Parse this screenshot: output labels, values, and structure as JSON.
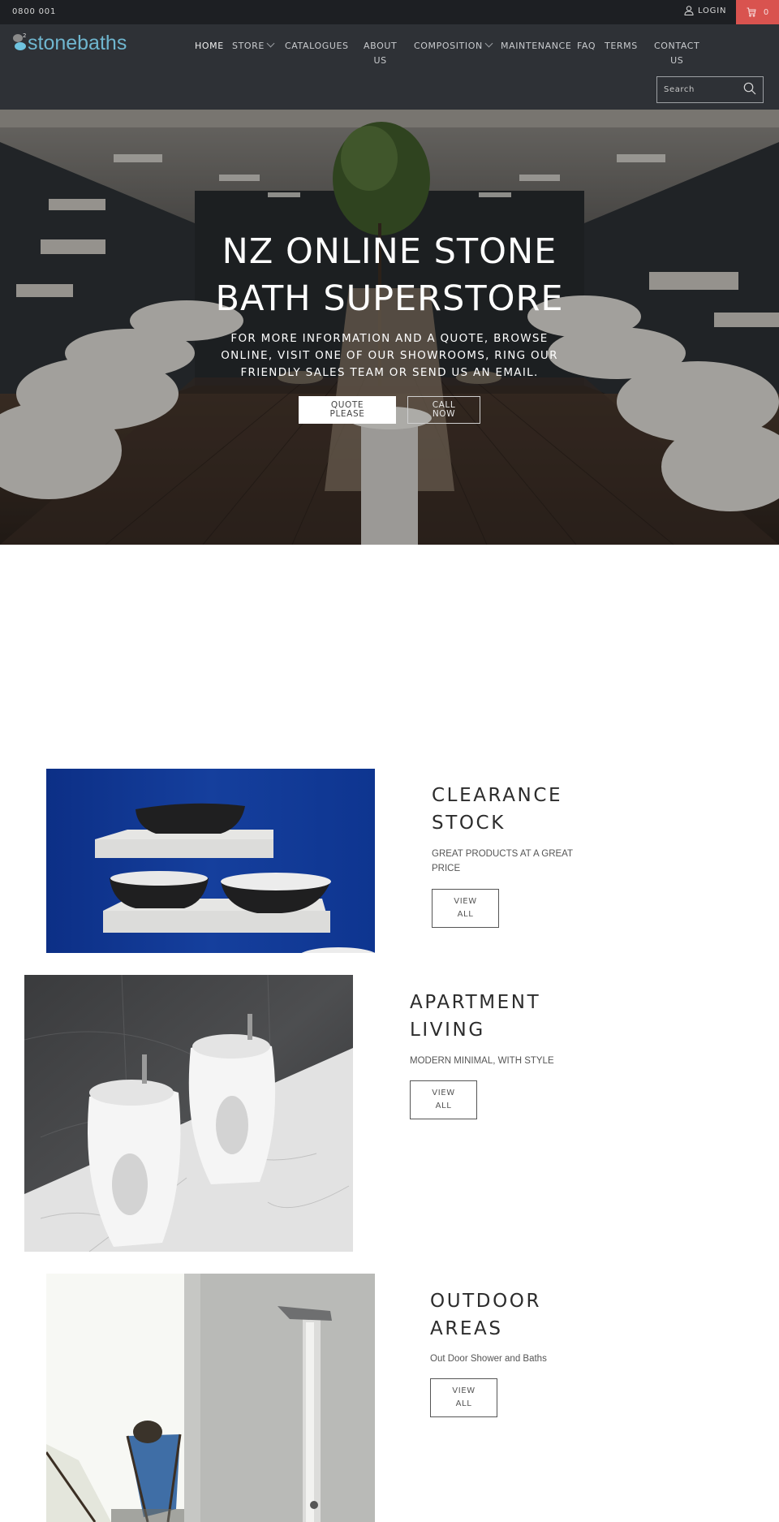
{
  "topbar": {
    "phone": "0800 001",
    "login_label": "LOGIN",
    "cart_count": "0",
    "cart_color": "#d9534f"
  },
  "header": {
    "logo_text": "stonebaths",
    "logo_superscript": "2",
    "nav": [
      {
        "label": "HOME",
        "active": true
      },
      {
        "label": "STORE",
        "has_dropdown": true
      },
      {
        "label": "CATALOGUES"
      },
      {
        "label_line1": "ABOUT",
        "label_line2": "US"
      },
      {
        "label": "COMPOSITION",
        "has_dropdown": true
      },
      {
        "label": "MAINTENANCE"
      },
      {
        "label": "FAQ"
      },
      {
        "label": "TERMS"
      },
      {
        "label_line1": "CONTACT",
        "label_line2": "US"
      }
    ],
    "search_placeholder": "Search"
  },
  "hero": {
    "title_line1": "NZ ONLINE STONE",
    "title_line2": "BATH SUPERSTORE",
    "subtitle": "FOR MORE INFORMATION AND A QUOTE, BROWSE ONLINE, VISIT ONE OF OUR SHOWROOMS, RING OUR FRIENDLY SALES TEAM OR SEND US AN EMAIL.",
    "quote_button_line1": "QUOTE",
    "quote_button_line2": "PLEASE",
    "call_button_line1": "CALL",
    "call_button_line2": "NOW"
  },
  "features": [
    {
      "title_line1": "CLEARANCE",
      "title_line2": "STOCK",
      "subtitle_line1": "GREAT PRODUCTS AT A GREAT",
      "subtitle_line2": "PRICE",
      "button_line1": "VIEW",
      "button_line2": "ALL"
    },
    {
      "title_line1": "APARTMENT",
      "title_line2": "LIVING",
      "subtitle_line1": "MODERN MINIMAL, WITH STYLE",
      "button_line1": "VIEW",
      "button_line2": "ALL"
    },
    {
      "title_line1": "OUTDOOR",
      "title_line2": "AREAS",
      "subtitle_line1": "Out Door Shower and Baths",
      "button_line1": "VIEW",
      "button_line2": "ALL"
    }
  ]
}
